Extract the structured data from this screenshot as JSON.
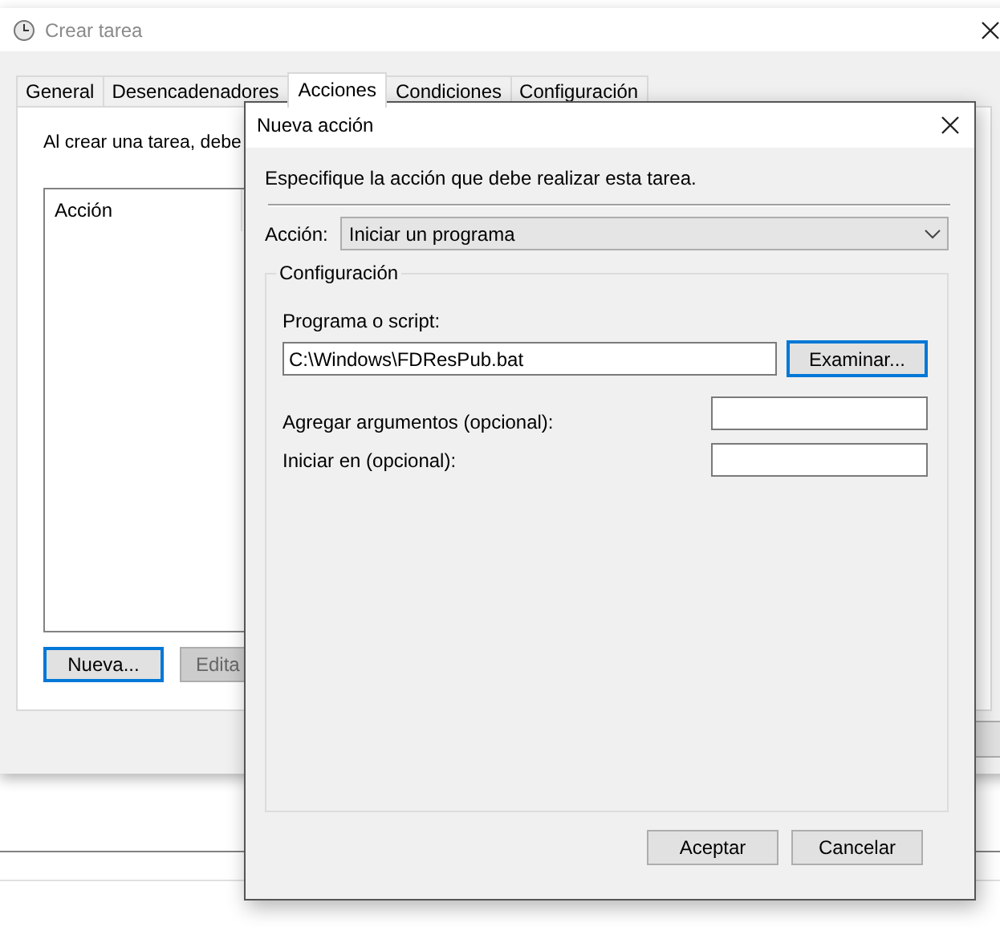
{
  "window": {
    "title": "Crear tarea"
  },
  "tabs": [
    {
      "label": "General",
      "selected": false
    },
    {
      "label": "Desencadenadores",
      "selected": false
    },
    {
      "label": "Acciones",
      "selected": true
    },
    {
      "label": "Condiciones",
      "selected": false
    },
    {
      "label": "Configuración",
      "selected": false
    }
  ],
  "intro": "Al crear una tarea, debe",
  "actions_list": {
    "columns": [
      "Acción"
    ]
  },
  "list_buttons": [
    {
      "label": "Nueva...",
      "disabled": false,
      "focused": true
    },
    {
      "label": "Edita",
      "disabled": true,
      "focused": false
    }
  ],
  "dialog": {
    "title": "Nueva acción",
    "instruction": "Especifique la acción que debe realizar esta tarea.",
    "action_label": "Acción:",
    "action_value": "Iniciar un programa",
    "group": {
      "legend": "Configuración",
      "program_label": "Programa o script:",
      "program_value": "C:\\Windows\\FDResPub.bat",
      "browse_button": "Examinar...",
      "fields": [
        {
          "label": "Agregar argumentos (opcional):"
        },
        {
          "label": "Iniciar en (opcional):"
        }
      ]
    },
    "buttons": [
      "Aceptar",
      "Cancelar"
    ]
  }
}
